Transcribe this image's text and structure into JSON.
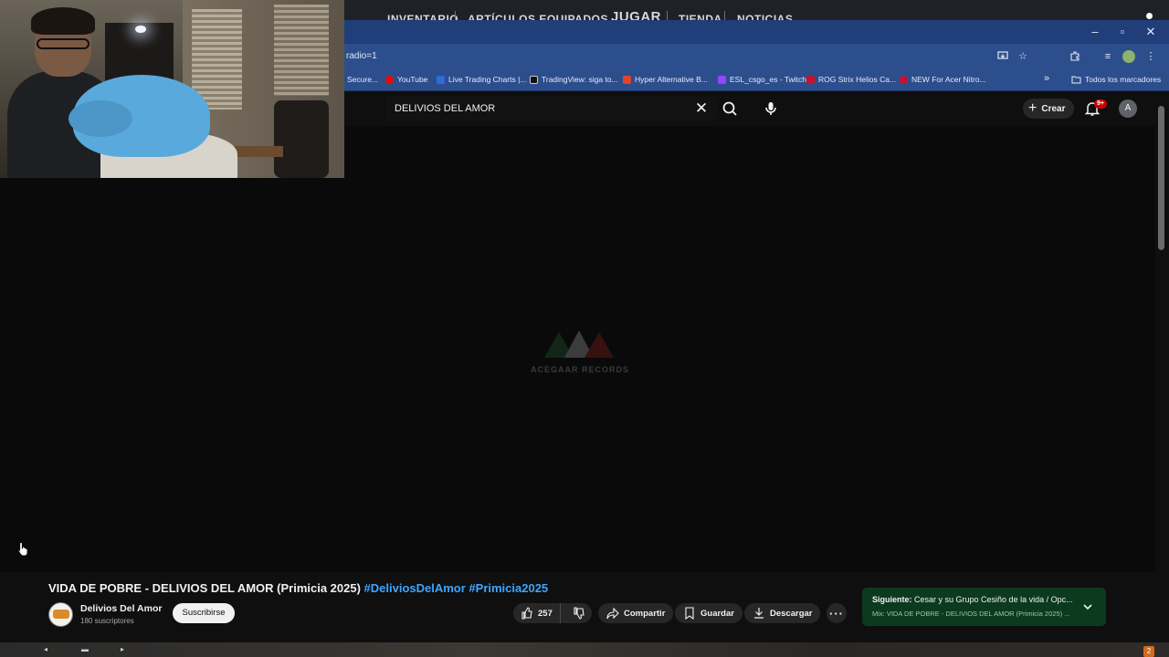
{
  "game_menu": {
    "items": [
      "INVENTARIO",
      "ARTÍCULOS EQUIPADOS",
      "JUGAR",
      "TIENDA",
      "NOTICIAS"
    ]
  },
  "browser": {
    "window_controls": {
      "minimize": "–",
      "restore": "▫",
      "close": "✕"
    },
    "address_text": "radio=1",
    "bookmarks": [
      {
        "label": "Secure...",
        "color": "#888888"
      },
      {
        "label": "YouTube",
        "color": "#ff0000"
      },
      {
        "label": "Live Trading Charts |...",
        "color": "#2f6bd8"
      },
      {
        "label": "TradingView: siga to...",
        "color": "#111111"
      },
      {
        "label": "Hyper Alternative B...",
        "color": "#e3432f"
      },
      {
        "label": "ESL_csgo_es - Twitch",
        "color": "#9146ff"
      },
      {
        "label": "ROG Strix Helios Ca...",
        "color": "#c8102e"
      },
      {
        "label": "NEW For Acer Nitro...",
        "color": "#c8102e"
      }
    ],
    "bookmarks_overflow": "»",
    "all_bookmarks_label": "Todos los marcadores"
  },
  "youtube": {
    "search_value": "DELIVIOS DEL AMOR",
    "create_label": "Crear",
    "notification_badge": "9+",
    "avatar_letter": "A"
  },
  "video": {
    "watermark": "ACEGAAR RECORDS",
    "title_main": "VIDA DE POBRE - DELIVIOS DEL AMOR (Primicia 2025) ",
    "hashtags": "#DeliviosDelAmor #Primicia2025",
    "channel_name": "Delivios Del Amor",
    "subscribers": "180 suscriptores",
    "subscribe_label": "Suscribirse",
    "like_count": "257",
    "share_label": "Compartir",
    "save_label": "Guardar",
    "download_label": "Descargar",
    "more_label": "···"
  },
  "up_next": {
    "prefix": "Siguiente:",
    "title": " Cesar y su Grupo Cesiño de la vida / Opc...",
    "subtitle": "Mix: VIDA DE POBRE - DELIVIOS DEL AMOR (Primicia 2025) ..."
  },
  "taskbar": {
    "notification_count": "2"
  },
  "colors": {
    "chrome_accent": "#2d4e8c",
    "youtube_bg": "#0f0f0f",
    "hashtag": "#3ea6ff",
    "next_panel": "#0b3a1f"
  }
}
